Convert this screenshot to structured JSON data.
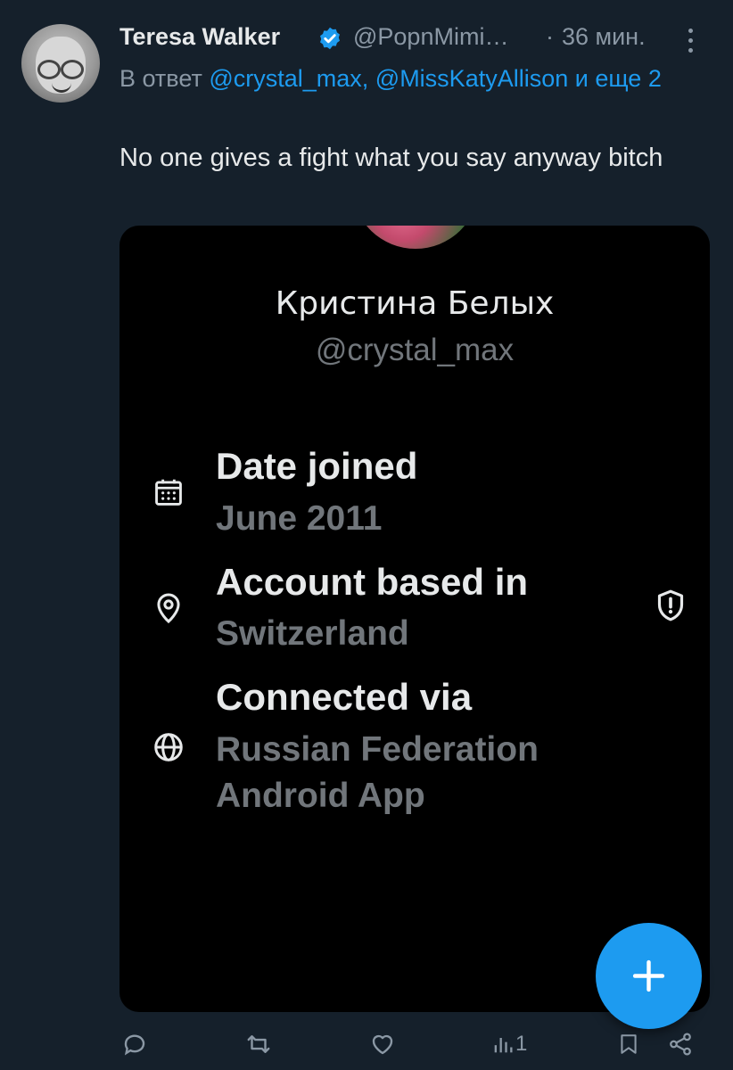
{
  "tweet": {
    "author_name": "Teresa Walker",
    "handle": "@PopnMimi…",
    "separator": "·",
    "time": "36 мин.",
    "reply_prefix": "В ответ",
    "reply_mentions": "@crystal_max, @MissKatyAllison",
    "reply_suffix": "и",
    "reply_more": "еще 2",
    "text": "No one gives a fight what you say anyway bitch"
  },
  "card": {
    "profile_name": "Кристина Белых",
    "profile_handle": "@crystal_max",
    "rows": [
      {
        "title": "Date joined",
        "value": "June 2011",
        "icon": "calendar-icon"
      },
      {
        "title": "Account based in",
        "value": "Switzerland",
        "icon": "location-pin-icon"
      },
      {
        "title": "Connected via",
        "value": "Russian Federation Android App",
        "icon": "globe-icon"
      }
    ]
  },
  "actions": {
    "views_count": "1"
  },
  "colors": {
    "background": "#15202b",
    "accent": "#1d9bf0",
    "muted": "#8b98a5"
  }
}
